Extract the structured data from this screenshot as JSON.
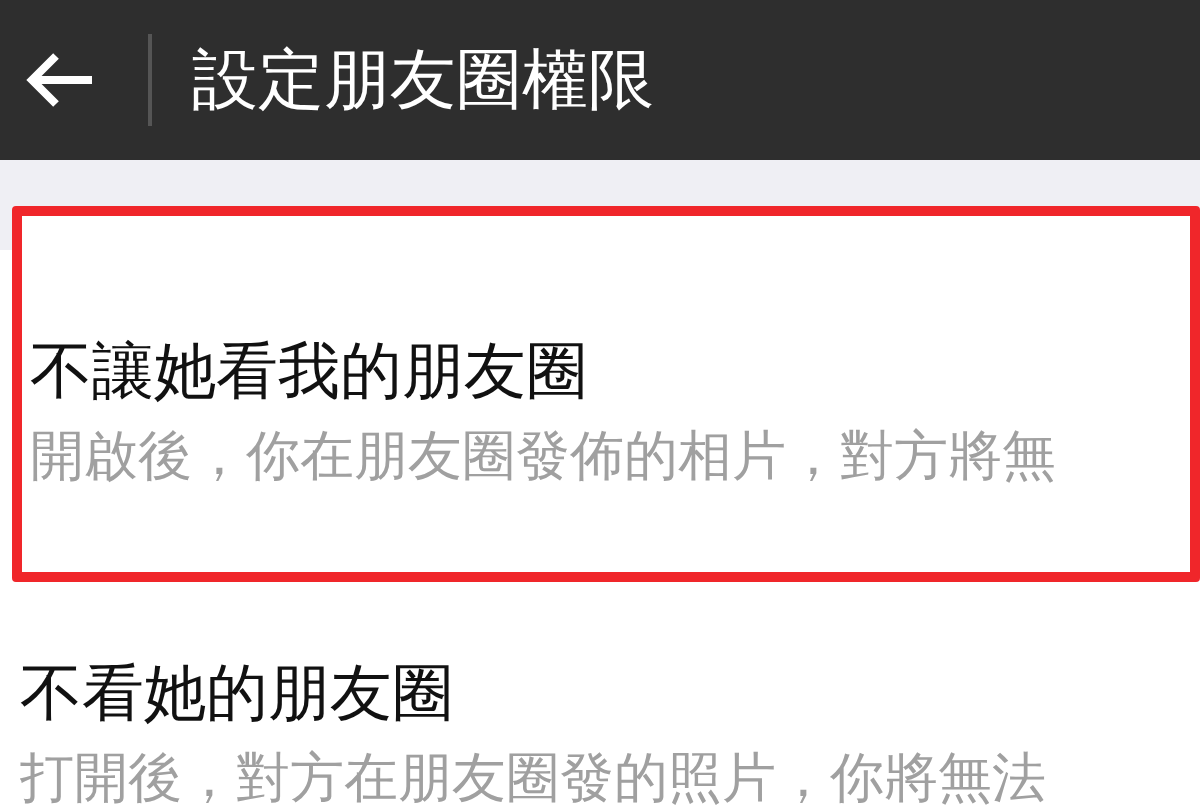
{
  "header": {
    "title": "設定朋友圈權限"
  },
  "items": [
    {
      "title": "不讓她看我的朋友圈",
      "description": "開啟後，你在朋友圈發佈的相片，對方將無",
      "highlighted": true
    },
    {
      "title": "不看她的朋友圈",
      "description": "打開後，對方在朋友圈發的照片，你將無法",
      "highlighted": false
    }
  ]
}
